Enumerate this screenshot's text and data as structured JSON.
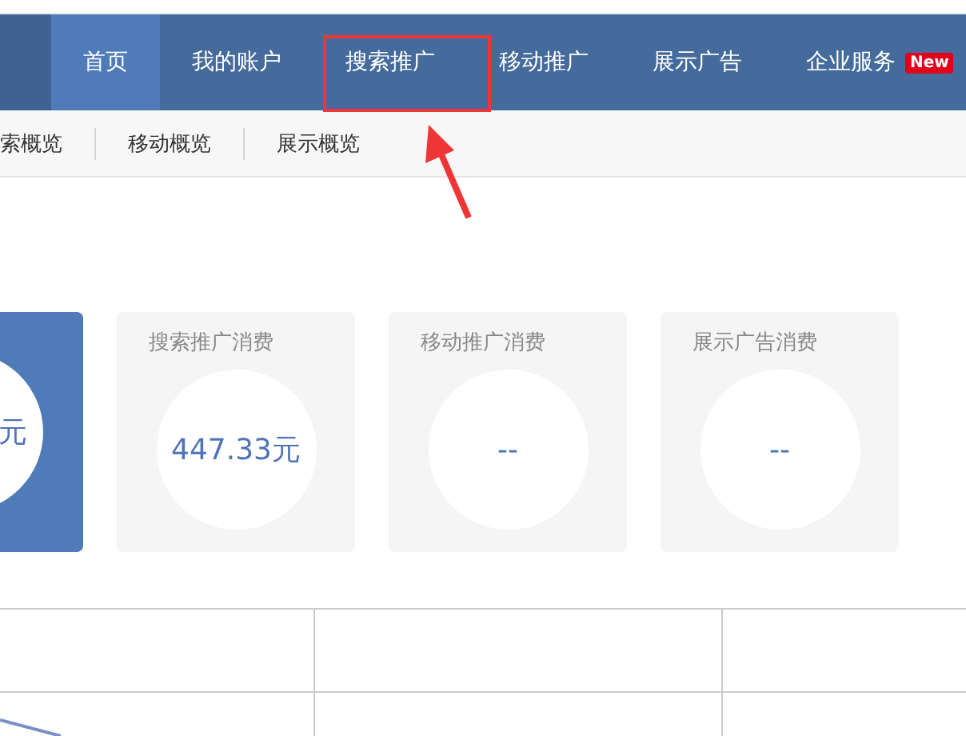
{
  "nav": {
    "items": [
      {
        "label": "首页",
        "selected": true
      },
      {
        "label": "我的账户",
        "selected": false
      },
      {
        "label": "搜索推广",
        "selected": false
      },
      {
        "label": "移动推广",
        "selected": false
      },
      {
        "label": "展示广告",
        "selected": false
      },
      {
        "label": "企业服务",
        "selected": false,
        "badge": "New"
      }
    ]
  },
  "sub_nav": {
    "items": [
      "索概览",
      "移动概览",
      "展示概览"
    ]
  },
  "cards": [
    {
      "value": "元",
      "selected": true
    },
    {
      "title": "搜索推广消费",
      "value": "447.33元",
      "selected": false
    },
    {
      "title": "移动推广消费",
      "value": "--",
      "selected": false
    },
    {
      "title": "展示广告消费",
      "value": "--",
      "selected": false
    }
  ]
}
